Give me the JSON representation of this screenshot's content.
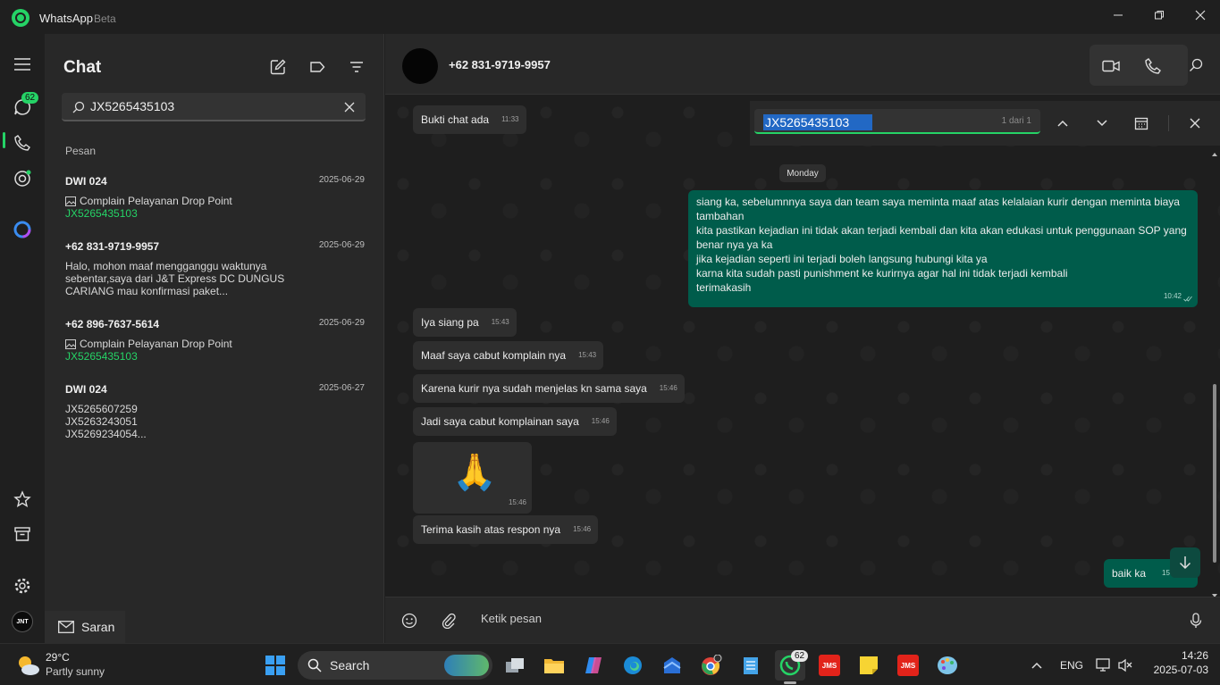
{
  "window": {
    "title": "WhatsApp",
    "subtitle": "Beta"
  },
  "rail": {
    "chats_badge": "62"
  },
  "sidebar": {
    "title": "Chat",
    "search_value": "JX5265435103",
    "section_label": "Pesan",
    "results": [
      {
        "name": "DWI 024",
        "date": "2025-06-29",
        "lines": [
          "Complain Pelayanan Drop Point"
        ],
        "highlight": "JX5265435103"
      },
      {
        "name": "+62 831-9719-9957",
        "date": "2025-06-29",
        "lines": [
          "Halo, mohon maaf mengganggu waktunya",
          "sebentar,saya dari J&T Express DC DUNGUS",
          "CARIANG mau konfirmasi paket..."
        ],
        "highlight": ""
      },
      {
        "name": "+62 896-7637-5614",
        "date": "2025-06-29",
        "lines": [
          "Complain Pelayanan Drop Point"
        ],
        "highlight": "JX5265435103"
      },
      {
        "name": "DWI 024",
        "date": "2025-06-27",
        "lines": [
          "JX5265607259",
          "JX5263243051",
          "JX5269234054..."
        ],
        "highlight": ""
      }
    ],
    "saran_label": "Saran"
  },
  "chat": {
    "contact": "+62 831-9719-9957",
    "find": {
      "query": "JX5265435103",
      "count": "1 dari 1"
    },
    "date_chip": "Monday",
    "messages": [
      {
        "text": "Bukti chat ada",
        "time": "11:33"
      },
      {
        "text": "Iya siang pa",
        "time": "15:43"
      },
      {
        "text": "Maaf saya cabut komplain nya",
        "time": "15:43"
      },
      {
        "text": "Karena kurir nya sudah menjelas kn sama saya",
        "time": "15:46"
      },
      {
        "text": "Jadi saya cabut komplainan saya",
        "time": "15:46"
      },
      {
        "text": "🙏",
        "time": "15:46"
      },
      {
        "text": "Terima kasih atas respon nya",
        "time": "15:46"
      }
    ],
    "outgoing": {
      "lines": [
        "siang ka, sebelumnnya saya dan team saya meminta maaf atas kelalaian kurir dengan meminta biaya",
        "tambahan",
        "kita pastikan kejadian ini tidak akan terjadi kembali dan kita akan edukasi untuk penggunaan SOP yang",
        "benar nya ya ka",
        "jika kejadian seperti ini terjadi boleh langsung hubungi kita ya",
        "karna kita sudah pasti punishment ke kurirnya agar hal ini tidak terjadi kembali",
        "terimakasih"
      ],
      "time": "10:42"
    },
    "outgoing_2": {
      "text": "baik ka",
      "time": "15"
    },
    "composer_placeholder": "Ketik pesan"
  },
  "taskbar": {
    "weather_temp": "29°C",
    "weather_desc": "Partly sunny",
    "search_label": "Search",
    "whatsapp_badge": "62",
    "lang": "ENG",
    "time": "14:26",
    "date": "2025-07-03"
  },
  "colors": {
    "accent": "#25d366",
    "outgoing_bubble": "#005c4b",
    "incoming_bubble": "#2e2e2e"
  }
}
